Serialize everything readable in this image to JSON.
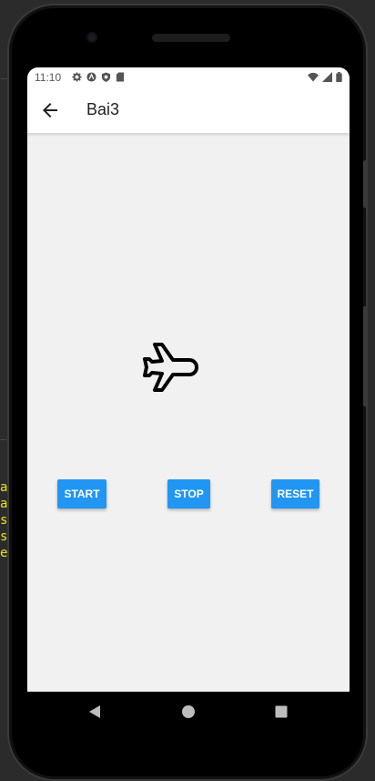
{
  "status_bar": {
    "time": "11:10",
    "left_icons": [
      "settings-icon",
      "vpn-icon",
      "shield-icon",
      "sd-card-icon"
    ],
    "right_icons": [
      "wifi-icon",
      "signal-icon",
      "battery-icon"
    ]
  },
  "app_bar": {
    "title": "Bai3",
    "back_icon": "arrow-back-icon"
  },
  "content": {
    "icon": "airplane-icon",
    "buttons": [
      {
        "label": "START"
      },
      {
        "label": "STOP"
      },
      {
        "label": "RESET"
      }
    ]
  },
  "nav_bar": {
    "icons": [
      "back-triangle-icon",
      "home-circle-icon",
      "recents-square-icon"
    ]
  },
  "background_text": [
    "a",
    "a",
    "s",
    "s",
    "e"
  ],
  "colors": {
    "button": "#2196f3",
    "button_text": "#ffffff",
    "screen_bg": "#f1f1f1",
    "app_bar_bg": "#ffffff",
    "side_text": "#f2e21a"
  }
}
